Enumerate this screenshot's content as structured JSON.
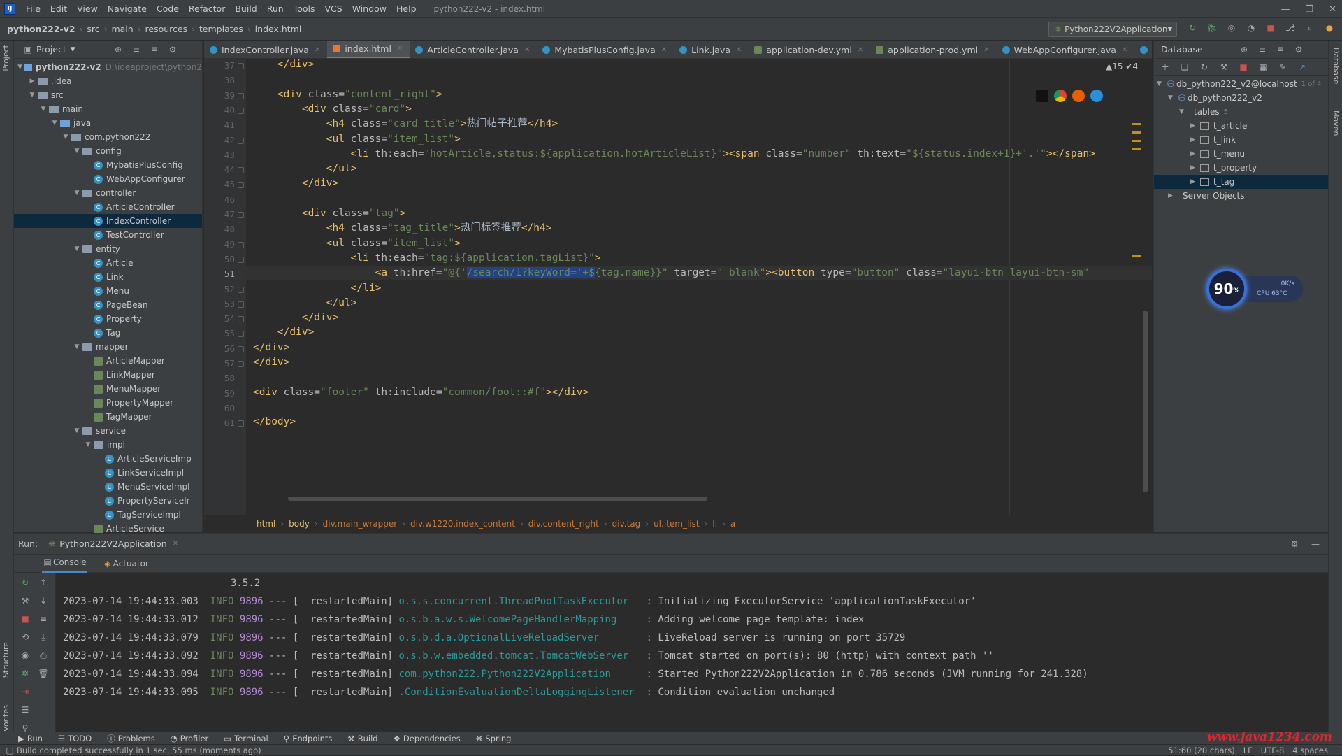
{
  "menubar": {
    "items": [
      "File",
      "Edit",
      "View",
      "Navigate",
      "Code",
      "Refactor",
      "Build",
      "Run",
      "Tools",
      "VCS",
      "Window",
      "Help"
    ],
    "window_title": "python222-v2 - index.html"
  },
  "navbar": {
    "breadcrumbs": [
      "python222-v2",
      "src",
      "main",
      "resources",
      "templates",
      "index.html"
    ],
    "run_config": "Python222V2Application"
  },
  "project_panel": {
    "title": "Project",
    "root_label": "python222-v2",
    "root_path": "D:\\ideaproject\\python2",
    "tree": [
      {
        "label": "python222-v2",
        "depth": 0,
        "kind": "folder-blue",
        "open": true
      },
      {
        "label": ".idea",
        "depth": 1,
        "kind": "folder",
        "open": false
      },
      {
        "label": "src",
        "depth": 1,
        "kind": "folder",
        "open": true
      },
      {
        "label": "main",
        "depth": 2,
        "kind": "folder",
        "open": true
      },
      {
        "label": "java",
        "depth": 3,
        "kind": "folder-blue",
        "open": true
      },
      {
        "label": "com.python222",
        "depth": 4,
        "kind": "folder",
        "open": true
      },
      {
        "label": "config",
        "depth": 5,
        "kind": "folder",
        "open": true
      },
      {
        "label": "MybatisPlusConfig",
        "depth": 6,
        "kind": "class"
      },
      {
        "label": "WebAppConfigurer",
        "depth": 6,
        "kind": "class"
      },
      {
        "label": "controller",
        "depth": 5,
        "kind": "folder",
        "open": true
      },
      {
        "label": "ArticleController",
        "depth": 6,
        "kind": "class"
      },
      {
        "label": "IndexController",
        "depth": 6,
        "kind": "class",
        "selected": true
      },
      {
        "label": "TestController",
        "depth": 6,
        "kind": "class"
      },
      {
        "label": "entity",
        "depth": 5,
        "kind": "folder",
        "open": true
      },
      {
        "label": "Article",
        "depth": 6,
        "kind": "class"
      },
      {
        "label": "Link",
        "depth": 6,
        "kind": "class"
      },
      {
        "label": "Menu",
        "depth": 6,
        "kind": "class"
      },
      {
        "label": "PageBean",
        "depth": 6,
        "kind": "class"
      },
      {
        "label": "Property",
        "depth": 6,
        "kind": "class"
      },
      {
        "label": "Tag",
        "depth": 6,
        "kind": "class"
      },
      {
        "label": "mapper",
        "depth": 5,
        "kind": "folder",
        "open": true
      },
      {
        "label": "ArticleMapper",
        "depth": 6,
        "kind": "iface"
      },
      {
        "label": "LinkMapper",
        "depth": 6,
        "kind": "iface"
      },
      {
        "label": "MenuMapper",
        "depth": 6,
        "kind": "iface"
      },
      {
        "label": "PropertyMapper",
        "depth": 6,
        "kind": "iface"
      },
      {
        "label": "TagMapper",
        "depth": 6,
        "kind": "iface"
      },
      {
        "label": "service",
        "depth": 5,
        "kind": "folder",
        "open": true
      },
      {
        "label": "impl",
        "depth": 6,
        "kind": "folder",
        "open": true
      },
      {
        "label": "ArticleServiceImp",
        "depth": 7,
        "kind": "class"
      },
      {
        "label": "LinkServiceImpl",
        "depth": 7,
        "kind": "class"
      },
      {
        "label": "MenuServiceImpl",
        "depth": 7,
        "kind": "class"
      },
      {
        "label": "PropertyServiceIr",
        "depth": 7,
        "kind": "class"
      },
      {
        "label": "TagServiceImpl",
        "depth": 7,
        "kind": "class"
      },
      {
        "label": "ArticleService",
        "depth": 6,
        "kind": "iface"
      }
    ]
  },
  "editor_tabs": [
    {
      "label": "IndexController.java",
      "kind": "java"
    },
    {
      "label": "index.html",
      "kind": "html",
      "active": true
    },
    {
      "label": "ArticleController.java",
      "kind": "java"
    },
    {
      "label": "MybatisPlusConfig.java",
      "kind": "java"
    },
    {
      "label": "Link.java",
      "kind": "java"
    },
    {
      "label": "application-dev.yml",
      "kind": "yml"
    },
    {
      "label": "application-prod.yml",
      "kind": "yml"
    },
    {
      "label": "WebAppConfigurer.java",
      "kind": "java"
    },
    {
      "label": "PageUti",
      "kind": "java"
    }
  ],
  "editor": {
    "warnings": "▲15 ✔4",
    "current_line": "51",
    "lines": [
      {
        "n": "37",
        "indent": 0,
        "html": "<span class='t'>    &lt;/div&gt;</span>"
      },
      {
        "n": "38",
        "indent": 0,
        "html": ""
      },
      {
        "n": "39",
        "indent": 0,
        "html": "<span class='t'>    &lt;div </span><span class='a'>class=</span><span class='s'>\"content_right\"</span><span class='t'>&gt;</span>"
      },
      {
        "n": "40",
        "indent": 0,
        "html": "<span class='t'>        &lt;div </span><span class='a'>class=</span><span class='s'>\"card\"</span><span class='t'>&gt;</span>"
      },
      {
        "n": "41",
        "indent": 0,
        "html": "<span class='t'>            &lt;h4 </span><span class='a'>class=</span><span class='s'>\"card_title\"</span><span class='t'>&gt;</span>热门帖子推荐<span class='t'>&lt;/h4&gt;</span>"
      },
      {
        "n": "42",
        "indent": 0,
        "html": "<span class='t'>            &lt;ul </span><span class='a'>class=</span><span class='s'>\"item_list\"</span><span class='t'>&gt;</span>"
      },
      {
        "n": "43",
        "indent": 0,
        "html": "<span class='t'>                &lt;li </span><span class='a'>th:each=</span><span class='s'>\"hotArticle,status:${application.hotArticleList}\"</span><span class='t'>&gt;&lt;span </span><span class='a'>class=</span><span class='s'>\"number\"</span><span class='a'> th:text=</span><span class='s'>\"${status.index+1}+'.'\"</span><span class='t'>&gt;&lt;/span&gt;</span>"
      },
      {
        "n": "44",
        "indent": 0,
        "html": "<span class='t'>            &lt;/ul&gt;</span>"
      },
      {
        "n": "45",
        "indent": 0,
        "html": "<span class='t'>        &lt;/div&gt;</span>"
      },
      {
        "n": "46",
        "indent": 0,
        "html": ""
      },
      {
        "n": "47",
        "indent": 0,
        "html": "<span class='t'>        &lt;div </span><span class='a'>class=</span><span class='s'>\"tag\"</span><span class='t'>&gt;</span>"
      },
      {
        "n": "48",
        "indent": 0,
        "html": "<span class='t'>            &lt;h4 </span><span class='a'>class=</span><span class='s'>\"tag_title\"</span><span class='t'>&gt;</span>热门标签推荐<span class='t'>&lt;/h4&gt;</span>"
      },
      {
        "n": "49",
        "indent": 0,
        "html": "<span class='t'>            &lt;ul </span><span class='a'>class=</span><span class='s'>\"item_list\"</span><span class='t'>&gt;</span>"
      },
      {
        "n": "50",
        "indent": 0,
        "html": "<span class='t'>                &lt;li </span><span class='a'>th:each=</span><span class='s'>\"tag:${application.tagList}\"</span><span class='t'>&gt;</span>"
      },
      {
        "n": "51",
        "indent": 0,
        "cur": true,
        "html": "<span class='t'>                    &lt;a </span><span class='a'>th:href=</span><span class='s'>\"@{'</span><span class='sel-txt'>/search/1?keyWord='+$</span><span class='s'>{tag.name}}\"</span><span class='a'> target=</span><span class='s'>\"_blank\"</span><span class='t'>&gt;&lt;button </span><span class='a'>type=</span><span class='s'>\"button\"</span><span class='a'> class=</span><span class='s'>\"layui-btn layui-btn-sm\"</span>"
      },
      {
        "n": "52",
        "indent": 0,
        "html": "<span class='t'>                &lt;/li&gt;</span>"
      },
      {
        "n": "53",
        "indent": 0,
        "html": "<span class='t'>            &lt;/ul&gt;</span>"
      },
      {
        "n": "54",
        "indent": 0,
        "html": "<span class='t'>        &lt;/div&gt;</span>"
      },
      {
        "n": "55",
        "indent": 0,
        "html": "<span class='t'>    &lt;/div&gt;</span>"
      },
      {
        "n": "56",
        "indent": 0,
        "html": "<span class='t'>&lt;/div&gt;</span>"
      },
      {
        "n": "57",
        "indent": 0,
        "html": "<span class='t'>&lt;/div&gt;</span>"
      },
      {
        "n": "58",
        "indent": 0,
        "html": ""
      },
      {
        "n": "59",
        "indent": 0,
        "html": "<span class='t'>&lt;div </span><span class='a'>class=</span><span class='s'>\"footer\"</span><span class='a'> th:include=</span><span class='s'>\"common/foot::#f\"</span><span class='t'>&gt;&lt;/div&gt;</span>"
      },
      {
        "n": "60",
        "indent": 0,
        "html": ""
      },
      {
        "n": "61",
        "indent": 0,
        "html": "<span class='t'>&lt;/body&gt;</span>"
      }
    ]
  },
  "editor_breadcrumb": [
    "html",
    "body",
    "div.main_wrapper",
    "div.w1220.index_content",
    "div.content_right",
    "div.tag",
    "ul.item_list",
    "li",
    "a"
  ],
  "database_panel": {
    "title": "Database",
    "rows": [
      {
        "label": "db_python222_v2@localhost",
        "hint": "1 of 4",
        "depth": 0
      },
      {
        "label": "db_python222_v2",
        "depth": 1
      },
      {
        "label": "tables",
        "hint": "5",
        "depth": 2,
        "folder": true
      },
      {
        "label": "t_article",
        "depth": 3,
        "table": true
      },
      {
        "label": "t_link",
        "depth": 3,
        "table": true
      },
      {
        "label": "t_menu",
        "depth": 3,
        "table": true
      },
      {
        "label": "t_property",
        "depth": 3,
        "table": true
      },
      {
        "label": "t_tag",
        "depth": 3,
        "table": true,
        "selected": true
      },
      {
        "label": "Server Objects",
        "depth": 1,
        "folder": true
      }
    ]
  },
  "widget": {
    "value": "90",
    "unit": "%",
    "speed": "0K/s",
    "cpu": "CPU 63°C"
  },
  "run_panel": {
    "label": "Run:",
    "config_tab": "Python222V2Application",
    "subtabs": [
      "Console",
      "Actuator"
    ],
    "console_lines": [
      {
        "ts": "",
        "lvl": "",
        "pid": "",
        "thread": "",
        "logger": "",
        "msg": "3.5.2",
        "plain": true
      },
      {
        "ts": "2023-07-14 19:44:33.003",
        "lvl": "INFO",
        "pid": "9896",
        "thread": "restartedMain",
        "logger": "o.s.s.concurrent.ThreadPoolTaskExecutor  ",
        "msg": "Initializing ExecutorService 'applicationTaskExecutor'"
      },
      {
        "ts": "2023-07-14 19:44:33.012",
        "lvl": "INFO",
        "pid": "9896",
        "thread": "restartedMain",
        "logger": "o.s.b.a.w.s.WelcomePageHandlerMapping    ",
        "msg": "Adding welcome page template: index"
      },
      {
        "ts": "2023-07-14 19:44:33.079",
        "lvl": "INFO",
        "pid": "9896",
        "thread": "restartedMain",
        "logger": "o.s.b.d.a.OptionalLiveReloadServer       ",
        "msg": "LiveReload server is running on port 35729"
      },
      {
        "ts": "2023-07-14 19:44:33.092",
        "lvl": "INFO",
        "pid": "9896",
        "thread": "restartedMain",
        "logger": "o.s.b.w.embedded.tomcat.TomcatWebServer  ",
        "msg": "Tomcat started on port(s): 80 (http) with context path ''"
      },
      {
        "ts": "2023-07-14 19:44:33.094",
        "lvl": "INFO",
        "pid": "9896",
        "thread": "restartedMain",
        "logger": "com.python222.Python222V2Application     ",
        "msg": "Started Python222V2Application in 0.786 seconds (JVM running for 241.328)"
      },
      {
        "ts": "2023-07-14 19:44:33.095",
        "lvl": "INFO",
        "pid": "9896",
        "thread": "restartedMain",
        "logger": ".ConditionEvaluationDeltaLoggingListener ",
        "msg": "Condition evaluation unchanged"
      }
    ]
  },
  "bottom_tools": [
    "Run",
    "TODO",
    "Problems",
    "Profiler",
    "Terminal",
    "Endpoints",
    "Build",
    "Dependencies",
    "Spring"
  ],
  "statusbar": {
    "message": "Build completed successfully in 1 sec, 55 ms (moments ago)",
    "position": "51:60 (20 chars)",
    "line_sep": "LF",
    "encoding": "UTF-8",
    "indent": "4 spaces"
  },
  "watermark": "www.java1234.com",
  "left_strip": [
    "Project",
    "Structure",
    "Favorites"
  ],
  "right_strip": [
    "Database",
    "Maven"
  ]
}
